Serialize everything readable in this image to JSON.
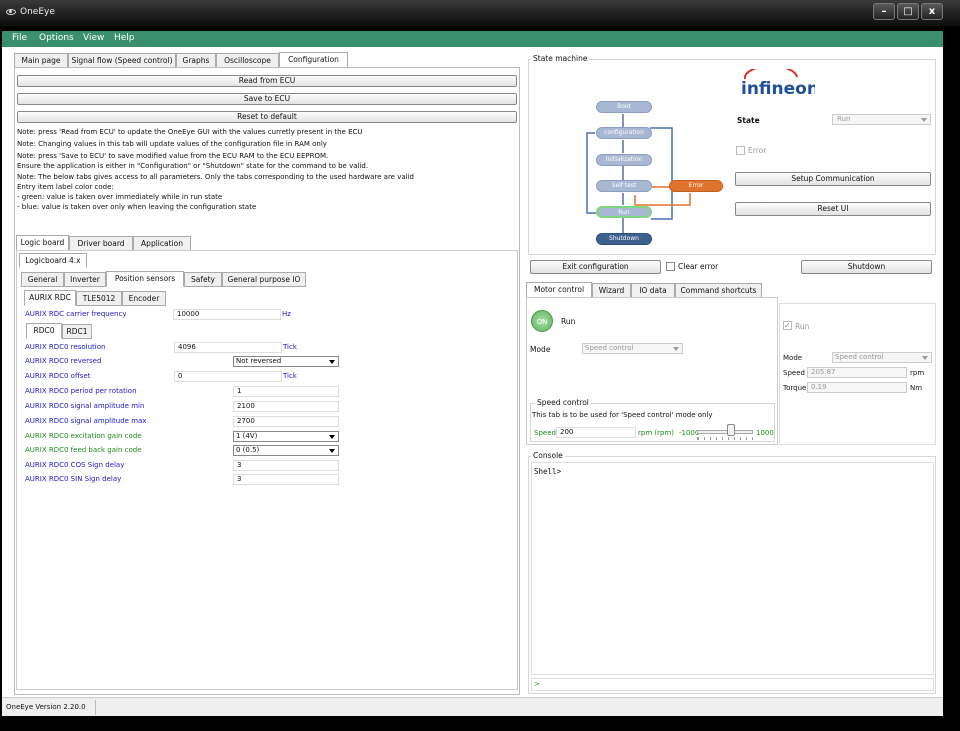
{
  "window": {
    "title": "OneEye",
    "min": "–",
    "max": "□",
    "close": "x"
  },
  "menu": [
    "File",
    "Options",
    "View",
    "Help"
  ],
  "main_tabs": [
    "Main page",
    "Signal flow (Speed control)",
    "Graphs",
    "Oscilloscope",
    "Configuration"
  ],
  "config": {
    "read_btn": "Read from ECU",
    "save_btn": "Save to ECU",
    "reset_btn": "Reset to default",
    "notes": [
      "Note: press 'Read from ECU' to update the OneEye GUI with the values curretly present in the ECU",
      "Note: Changing values in this tab will update values of the configuration file in RAM only",
      "Note: press 'Save to ECU' to save modified value from the ECU RAM to the ECU EEPROM.",
      "Ensure the application is either in \"Configuration\" or \"Shutdown\" state for the command to be valid.",
      "Note: The below tabs gives access to all parameters. Only the tabs corresponding to the used hardware are valid",
      "Entry item label color code:",
      "- green: value is taken over immediately while in run state",
      "- blue: value is taken over only when leaving the configuration state"
    ],
    "board_tabs": [
      "Logic board",
      "Driver board",
      "Application"
    ],
    "logicboard_tab": "Logicboard 4.x",
    "param_tabs": [
      "General",
      "Inverter",
      "Position sensors",
      "Safety",
      "General purpose IO"
    ],
    "sensor_tabs": [
      "AURIX RDC",
      "TLE5012",
      "Encoder"
    ],
    "carrier": {
      "label": "AURIX RDC carrier frequency",
      "value": "10000",
      "unit": "Hz"
    },
    "rdc_tabs": [
      "RDC0",
      "RDC1"
    ],
    "params": [
      {
        "label": "AURIX RDC0 resolution",
        "value": "4096",
        "unit": "Tick",
        "kind": "field1",
        "color": "blue"
      },
      {
        "label": "AURIX RDC0 reversed",
        "value": "Not reversed",
        "unit": "",
        "kind": "combo",
        "color": "blue"
      },
      {
        "label": "AURIX RDC0 offset",
        "value": "0",
        "unit": "Tick",
        "kind": "field1",
        "color": "blue"
      },
      {
        "label": "AURIX RDC0 period per rotation",
        "value": "1",
        "unit": "",
        "kind": "field2",
        "color": "blue"
      },
      {
        "label": "AURIX RDC0 signal amplitude min",
        "value": "2100",
        "unit": "",
        "kind": "field2",
        "color": "blue"
      },
      {
        "label": "AURIX RDC0 signal amplitude max",
        "value": "2700",
        "unit": "",
        "kind": "field2",
        "color": "blue"
      },
      {
        "label": "AURIX RDC0 excitation gain code",
        "value": "1 (4V)",
        "unit": "",
        "kind": "combo",
        "color": "green"
      },
      {
        "label": "AURIX RDC0 feed back gain code",
        "value": "0 (0.5)",
        "unit": "",
        "kind": "combo",
        "color": "green"
      },
      {
        "label": "AURIX RDC0 COS Sign delay",
        "value": "3",
        "unit": "",
        "kind": "field2",
        "color": "blue"
      },
      {
        "label": "AURIX RDC0 SIN Sign delay",
        "value": "3",
        "unit": "",
        "kind": "field2",
        "color": "blue"
      }
    ]
  },
  "state_machine": {
    "title": "State machine",
    "logo": "infineon",
    "nodes": [
      "Boot",
      "configuration",
      "Initialization",
      "Self test",
      "Run",
      "Shutdown",
      "Error"
    ],
    "state_label": "State",
    "state_value": "Run",
    "error_label": "Error",
    "setup_btn": "Setup Communication",
    "reset_ui_btn": "Reset UI",
    "exit_btn": "Exit configuration",
    "clear_error": "Clear error",
    "shutdown_btn": "Shutdown"
  },
  "motor": {
    "tabs": [
      "Motor control",
      "Wizard",
      "IO data",
      "Command shortcuts"
    ],
    "on_label": "ON",
    "run_label": "Run",
    "mode_label": "Mode",
    "mode_value": "Speed control",
    "speed_control_title": "Speed control",
    "speed_note": "This tab is to be used for 'Speed control' mode only",
    "speed_label": "Speed",
    "speed_value": "200",
    "speed_unit": "rpm (rpm)",
    "slider_min": "-1000",
    "slider_max": "1000",
    "slider_fraction": 0.6,
    "right_run": "Run",
    "right_mode_label": "Mode",
    "right_mode_value": "Speed control",
    "right_speed_label": "Speed",
    "right_speed_value": "205.87",
    "right_speed_unit": "rpm",
    "torque_label": "Torque",
    "torque_value": "0.19",
    "torque_unit": "Nm"
  },
  "console": {
    "title": "Console",
    "prompt": "Shell>",
    "input_prefix": ">"
  },
  "status": {
    "version": "OneEye Version 2.20.0"
  },
  "colors": {
    "menu": "#3a8f6e",
    "on_button": "#7ec87e",
    "error_node": "#e0742c",
    "shutdown_node": "#3d5f8f",
    "run_node_border": "#7fd87f",
    "logo": "#1e4f9c"
  }
}
